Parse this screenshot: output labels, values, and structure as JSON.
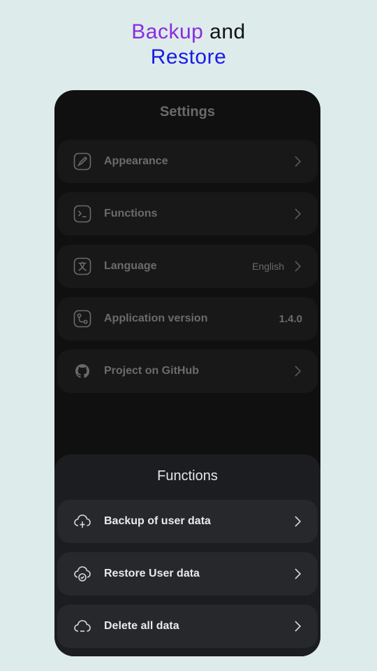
{
  "headline": {
    "word1": "Backup",
    "word2": "and",
    "word3": "Restore"
  },
  "settings": {
    "title": "Settings",
    "items": [
      {
        "label": "Appearance",
        "icon": "brush-icon"
      },
      {
        "label": "Functions",
        "icon": "terminal-icon"
      },
      {
        "label": "Language",
        "value": "English",
        "icon": "translate-icon"
      },
      {
        "label": "Application version",
        "value": "1.4.0",
        "icon": "version-icon"
      },
      {
        "label": "Project on GitHub",
        "icon": "github-icon"
      }
    ]
  },
  "sheet": {
    "title": "Functions",
    "items": [
      {
        "label": "Backup of user data",
        "icon": "cloud-upload-icon"
      },
      {
        "label": "Restore User data",
        "icon": "cloud-check-icon"
      },
      {
        "label": "Delete all data",
        "icon": "cloud-delete-icon"
      }
    ]
  },
  "colors": {
    "background": "#ddecea",
    "accent_purple": "#8a2be2",
    "accent_blue": "#1a1ae6"
  }
}
